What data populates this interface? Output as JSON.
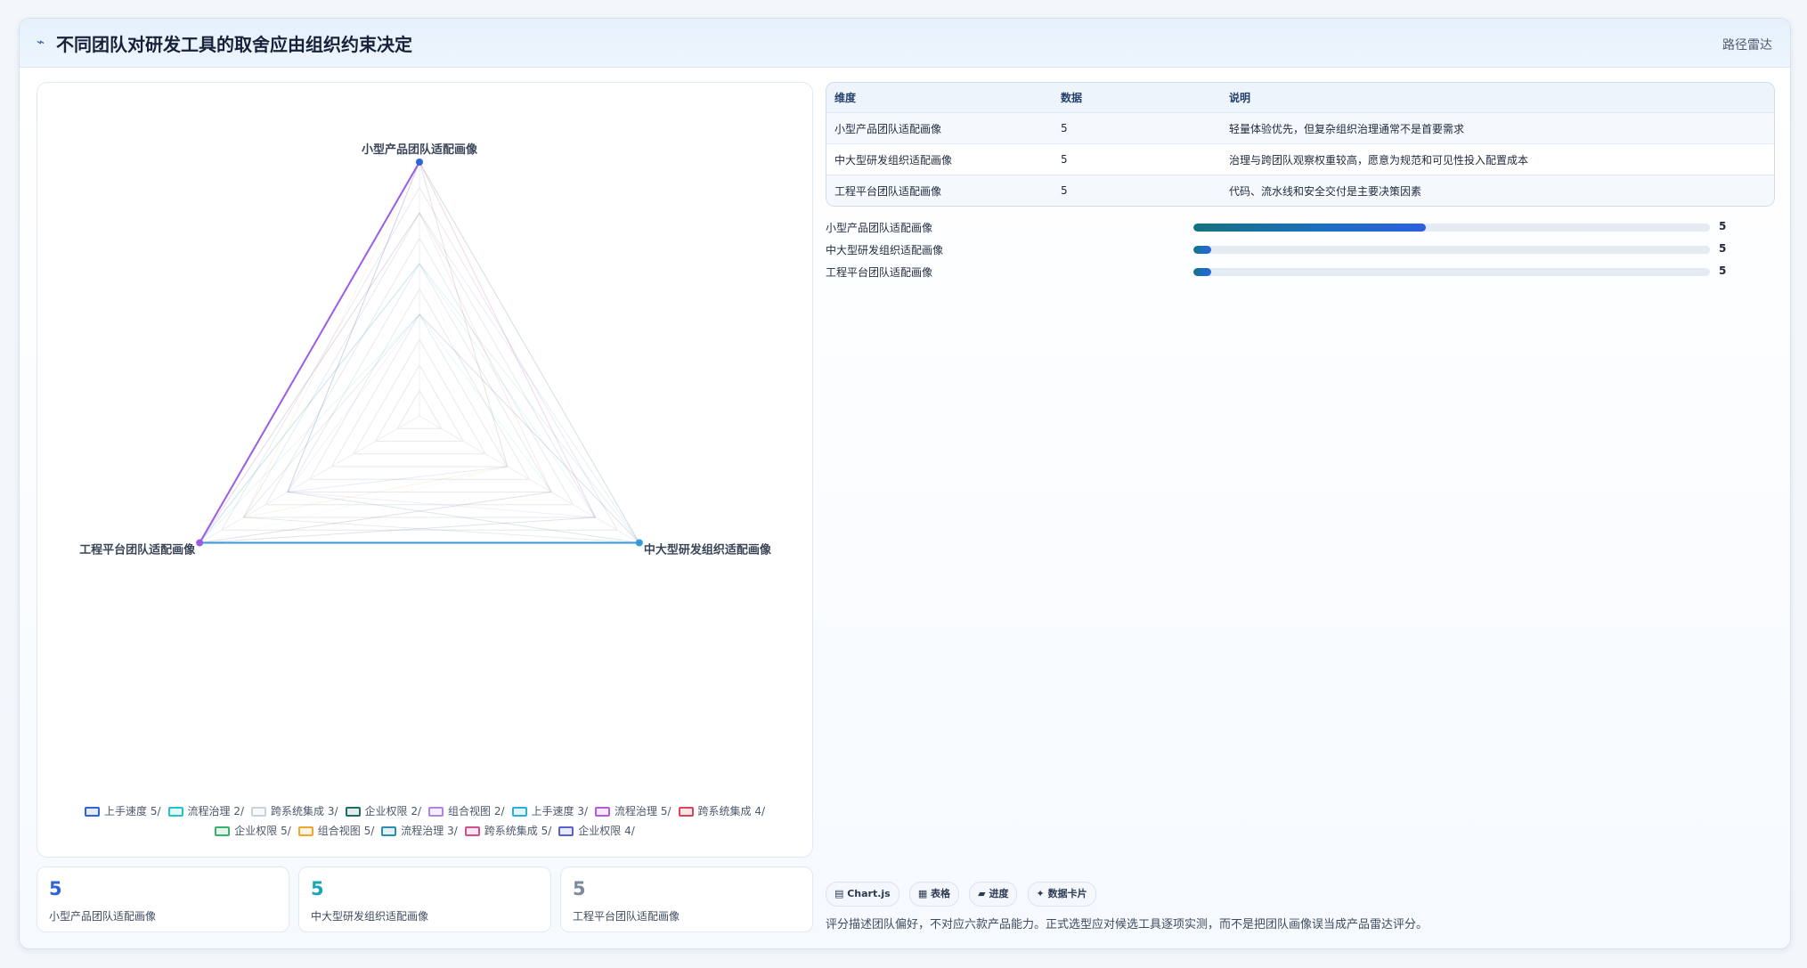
{
  "header": {
    "icon": "bolt-icon",
    "title": "不同团队对研发工具的取舍应由组织约束决定",
    "tag": "路径雷达"
  },
  "chart_data": {
    "type": "radar",
    "axes": [
      "小型产品团队适配画像",
      "中大型研发组织适配画像",
      "工程平台团队适配画像"
    ],
    "range": [
      0,
      5
    ],
    "grid_rings": 10,
    "series": [
      {
        "values": [
          5,
          2,
          3
        ],
        "color": "#2f63d6"
      },
      {
        "values": [
          2,
          3,
          5
        ],
        "color": "#27c2c8"
      },
      {
        "values": [
          3,
          2,
          5
        ],
        "color": "#c9d3de"
      },
      {
        "values": [
          2,
          5,
          4
        ],
        "color": "#1f6d66"
      },
      {
        "values": [
          2,
          5,
          3
        ],
        "color": "#b084e6"
      },
      {
        "values": [
          3,
          4,
          5
        ],
        "color": "#2cb1d6"
      },
      {
        "values": [
          5,
          4,
          3
        ],
        "color": "#b45be0"
      },
      {
        "values": [
          4,
          3,
          5
        ],
        "color": "#d9445a"
      },
      {
        "values": [
          5,
          5,
          3
        ],
        "color": "#39b36a"
      },
      {
        "values": [
          5,
          2,
          4
        ],
        "color": "#f0a52c"
      },
      {
        "values": [
          3,
          5,
          5
        ],
        "color": "#2a8fb3"
      },
      {
        "values": [
          5,
          4,
          5
        ],
        "color": "#d44d8c"
      },
      {
        "values": [
          4,
          5,
          5
        ],
        "color": "#5a5fd1"
      }
    ],
    "legend": [
      {
        "label": "上手速度 5/",
        "color": "#2f63d6"
      },
      {
        "label": "流程治理 2/",
        "color": "#27c2c8"
      },
      {
        "label": "跨系统集成 3/",
        "color": "#c9d3de"
      },
      {
        "label": "企业权限 2/",
        "color": "#1f6d66"
      },
      {
        "label": "组合视图 2/",
        "color": "#b084e6"
      },
      {
        "label": "上手速度 3/",
        "color": "#2cb1d6"
      },
      {
        "label": "流程治理 5/",
        "color": "#b45be0"
      },
      {
        "label": "跨系统集成 4/",
        "color": "#d9445a"
      },
      {
        "label": "企业权限 5/",
        "color": "#39b36a"
      },
      {
        "label": "组合视图 5/",
        "color": "#f0a52c"
      },
      {
        "label": "流程治理 3/",
        "color": "#2a8fb3"
      },
      {
        "label": "跨系统集成 5/",
        "color": "#d44d8c"
      },
      {
        "label": "企业权限 4/",
        "color": "#5a5fd1"
      }
    ],
    "legend_position": "bottom",
    "highlight_edges": [
      {
        "from": 0,
        "to": 2,
        "color": "#9b5de5"
      },
      {
        "from": 2,
        "to": 1,
        "color": "#3a9ad9"
      }
    ],
    "vertex_colors": [
      "#2f63d6",
      "#3a9ad9",
      "#9b5de5"
    ]
  },
  "stats": [
    {
      "value": "5",
      "label": "小型产品团队适配画像",
      "color": "#2f63d6"
    },
    {
      "value": "5",
      "label": "中大型研发组织适配画像",
      "color": "#1aa6b7"
    },
    {
      "value": "5",
      "label": "工程平台团队适配画像",
      "color": "#7d8a9c"
    }
  ],
  "table": {
    "headers": [
      "维度",
      "数据",
      "说明"
    ],
    "rows": [
      [
        "小型产品团队适配画像",
        "5",
        "轻量体验优先，但复杂组织治理通常不是首要需求"
      ],
      [
        "中大型研发组织适配画像",
        "5",
        "治理与跨团队观察权重较高，愿意为规范和可见性投入配置成本"
      ],
      [
        "工程平台团队适配画像",
        "5",
        "代码、流水线和安全交付是主要决策因素"
      ]
    ]
  },
  "progress": [
    {
      "label": "小型产品团队适配画像",
      "value": "5",
      "fraction": 0.45
    },
    {
      "label": "中大型研发组织适配画像",
      "value": "5",
      "fraction": 0.035
    },
    {
      "label": "工程平台团队适配画像",
      "value": "5",
      "fraction": 0.035
    }
  ],
  "chips": [
    "▤ Chart.js",
    "▦ 表格",
    "▰ 进度",
    "✦ 数据卡片"
  ],
  "note": "评分描述团队偏好，不对应六款产品能力。正式选型应对候选工具逐项实测，而不是把团队画像误当成产品雷达评分。"
}
